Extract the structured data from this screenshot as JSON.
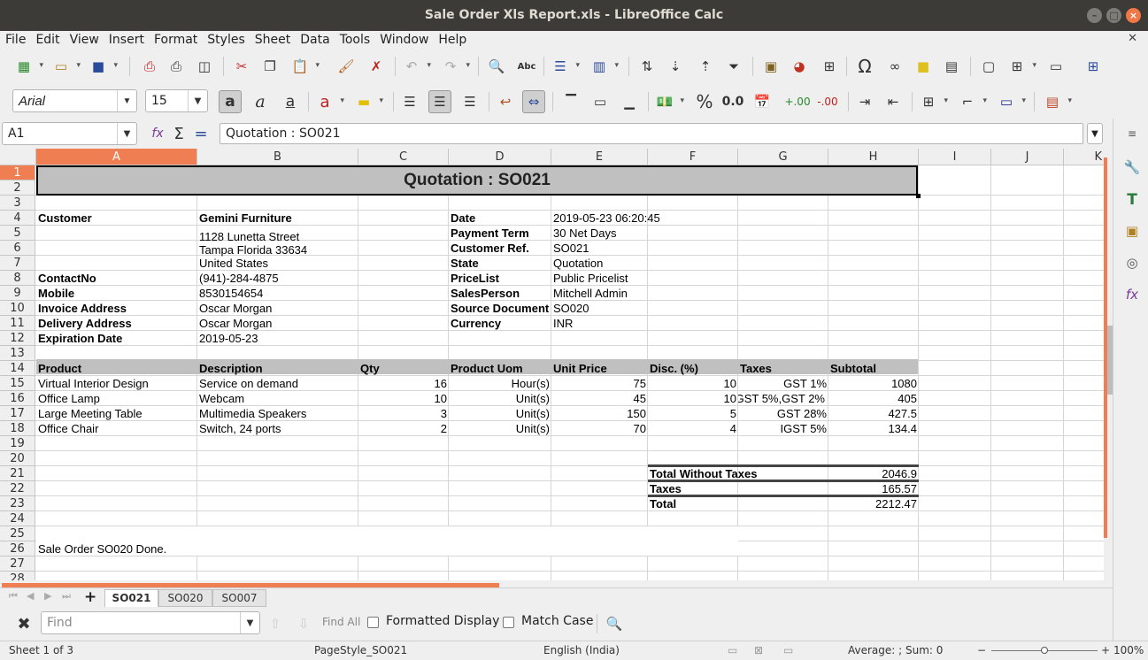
{
  "window": {
    "title": "Sale Order Xls Report.xls - LibreOffice Calc"
  },
  "menu": [
    "File",
    "Edit",
    "View",
    "Insert",
    "Format",
    "Styles",
    "Sheet",
    "Data",
    "Tools",
    "Window",
    "Help"
  ],
  "font": {
    "name": "Arial",
    "size": "15"
  },
  "formula": {
    "cell_ref": "A1",
    "content": "Quotation : SO021"
  },
  "columns": [
    "A",
    "B",
    "C",
    "D",
    "E",
    "F",
    "G",
    "H",
    "I",
    "J",
    "K"
  ],
  "rows": [
    "1",
    "2",
    "3",
    "4",
    "5",
    "6",
    "7",
    "8",
    "9",
    "10",
    "11",
    "12",
    "13",
    "14",
    "15",
    "16",
    "17",
    "18",
    "19",
    "20",
    "21",
    "22",
    "23",
    "24",
    "25",
    "26",
    "27",
    "28"
  ],
  "sheet": {
    "title": "Quotation : SO021",
    "left_info": [
      {
        "label": "Customer",
        "value": "Gemini Furniture"
      },
      {
        "label": "",
        "value": "1128 Lunetta Street"
      },
      {
        "label": "",
        "value": "Tampa Florida 33634"
      },
      {
        "label": "",
        "value": "United States"
      },
      {
        "label": "ContactNo",
        "value": "(941)-284-4875"
      },
      {
        "label": "Mobile",
        "value": "8530154654"
      },
      {
        "label": "Invoice Address",
        "value": "Oscar Morgan"
      },
      {
        "label": "Delivery Address",
        "value": "Oscar Morgan"
      },
      {
        "label": "Expiration Date",
        "value": "2019-05-23"
      }
    ],
    "right_info": [
      {
        "label": "Date",
        "value": "2019-05-23 06:20:45"
      },
      {
        "label": "Payment Term",
        "value": "30 Net Days"
      },
      {
        "label": "Customer Ref.",
        "value": "SO021"
      },
      {
        "label": "State",
        "value": "Quotation"
      },
      {
        "label": "PriceList",
        "value": "Public Pricelist"
      },
      {
        "label": "SalesPerson",
        "value": "Mitchell Admin"
      },
      {
        "label": "Source Document",
        "value": "SO020"
      },
      {
        "label": "Currency",
        "value": "INR"
      }
    ],
    "line_headers": [
      "Product",
      "Description",
      "Qty",
      "Product Uom",
      "Unit Price",
      "Disc. (%)",
      "Taxes",
      "Subtotal"
    ],
    "lines": [
      [
        "Virtual Interior Design",
        "Service on demand",
        "16",
        "Hour(s)",
        "75",
        "10",
        "GST 1%",
        "1080"
      ],
      [
        "Office Lamp",
        "Webcam",
        "10",
        "Unit(s)",
        "45",
        "10",
        "GST 5%,GST 2%",
        "405"
      ],
      [
        "Large Meeting Table",
        "Multimedia Speakers",
        "3",
        "Unit(s)",
        "150",
        "5",
        "GST 28%",
        "427.5"
      ],
      [
        "Office Chair",
        "Switch, 24 ports",
        "2",
        "Unit(s)",
        "70",
        "4",
        "IGST 5%",
        "134.4"
      ]
    ],
    "totals": [
      {
        "label": "Total Without Taxes",
        "value": "2046.9"
      },
      {
        "label": "Taxes",
        "value": "165.57"
      },
      {
        "label": "Total",
        "value": "2212.47"
      }
    ],
    "note": "Sale Order SO020 Done."
  },
  "tabs": [
    "SO021",
    "SO020",
    "SO007"
  ],
  "find": {
    "placeholder": "Find",
    "find_all": "Find All",
    "formatted_display": "Formatted Display",
    "match_case": "Match Case"
  },
  "status": {
    "sheet": "Sheet 1 of 3",
    "page_style": "PageStyle_SO021",
    "language": "English (India)",
    "summary": "Average: ; Sum: 0",
    "zoom": "100%"
  }
}
